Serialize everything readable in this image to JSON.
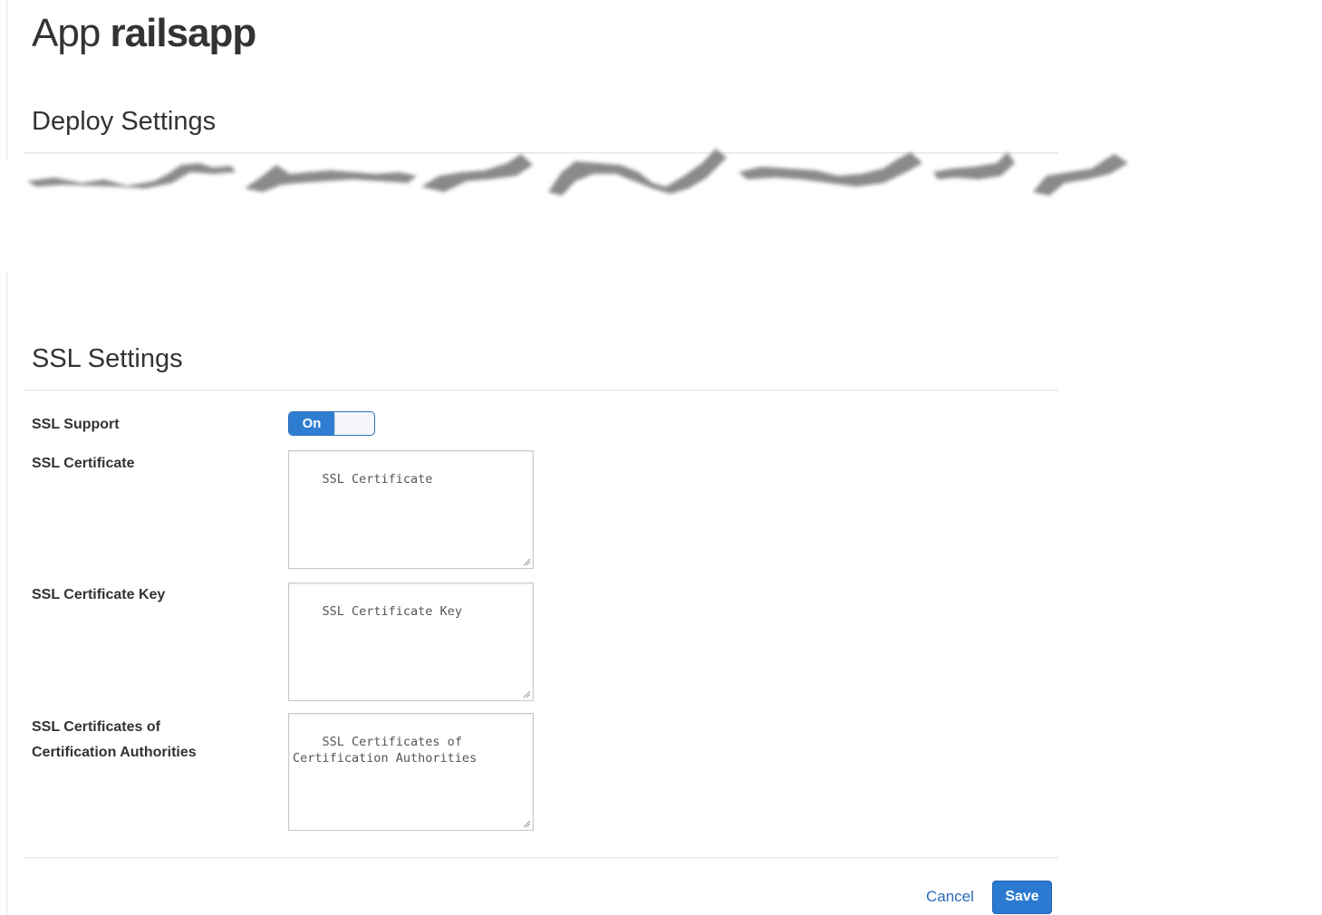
{
  "header": {
    "app_word": "App",
    "app_name": "railsapp"
  },
  "deploy_settings": {
    "heading": "Deploy Settings"
  },
  "ssl_settings": {
    "heading": "SSL Settings",
    "support": {
      "label": "SSL Support",
      "toggle_state": "On"
    },
    "certificate": {
      "label": "SSL Certificate",
      "placeholder": "SSL Certificate"
    },
    "certificate_key": {
      "label": "SSL Certificate Key",
      "placeholder": "SSL Certificate Key"
    },
    "ca_certificates": {
      "label": "SSL Certificates of Certification Authorities",
      "placeholder": "SSL Certificates of\nCertification Authorities"
    }
  },
  "footer": {
    "cancel_label": "Cancel",
    "save_label": "Save"
  },
  "colors": {
    "accent": "#2b79d0",
    "link": "#2b6cb8",
    "text": "#333333"
  }
}
